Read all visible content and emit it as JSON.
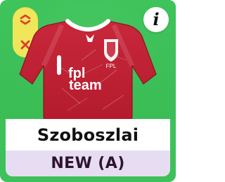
{
  "card": {
    "player_name": "Szoboszlai",
    "fixture": "NEW (A)"
  },
  "icons": {
    "swap": "swap-icon",
    "remove": "remove-icon",
    "info": "info-icon"
  },
  "info_label": "i",
  "shirt": {
    "sponsor_top": "fpl",
    "sponsor_bottom": "team",
    "crest_text": "FPL"
  },
  "colors": {
    "pitch_green": "#3ec15a",
    "control_yellow": "#f0e65a",
    "control_red": "#e23b2f",
    "shirt_red": "#c0202e",
    "fixture_bg": "#e7ddf2",
    "fixture_text": "#30142f"
  }
}
